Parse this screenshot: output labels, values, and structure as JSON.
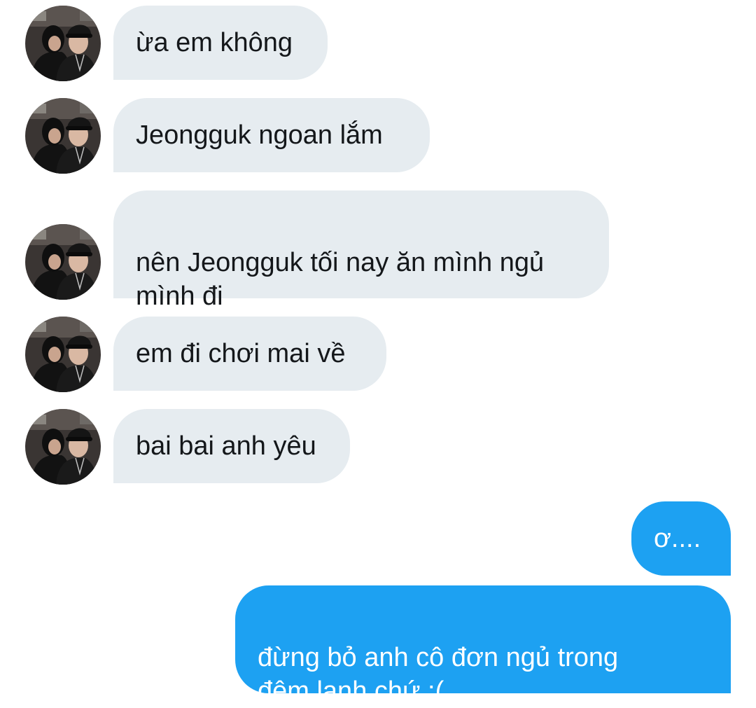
{
  "conversation": {
    "incoming_messages": [
      {
        "text": "ừa em không"
      },
      {
        "text": "Jeongguk ngoan lắm"
      },
      {
        "text": "nên Jeongguk tối nay ăn mình ngủ\nmình đi"
      },
      {
        "text": "em đi chơi mai về"
      },
      {
        "text": "bai bai anh yêu"
      }
    ],
    "outgoing_messages": [
      {
        "text": "ơ...."
      },
      {
        "text": "đừng bỏ anh cô đơn ngủ trong\nđêm lạnh chứ :("
      }
    ]
  },
  "colors": {
    "incoming_bubble": "#e6ecf0",
    "outgoing_bubble": "#1da1f2",
    "incoming_text": "#14171a",
    "outgoing_text": "#ffffff"
  },
  "icons": {
    "avatar": "contact-avatar-photo"
  }
}
